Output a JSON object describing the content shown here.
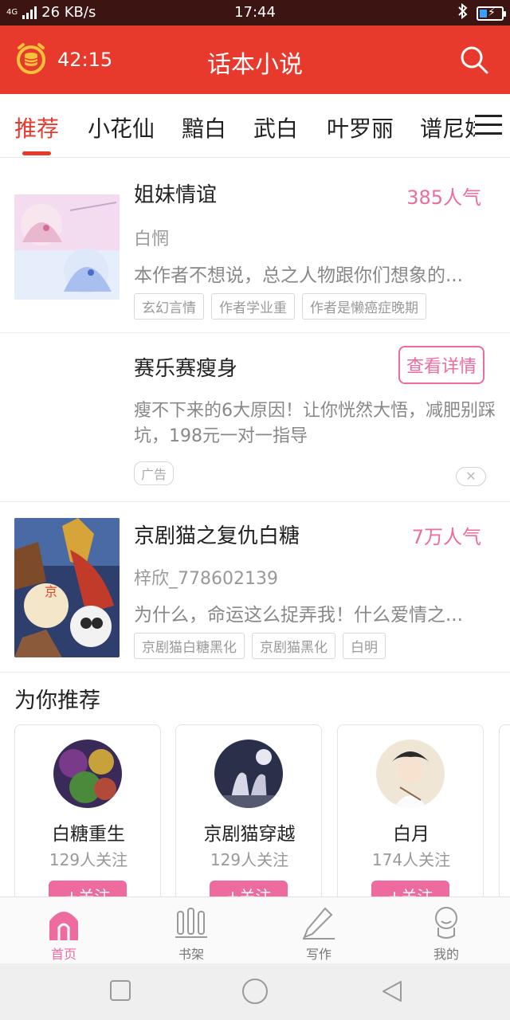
{
  "status_bar": {
    "network": "4G",
    "speed": "26 KB/s",
    "time": "17:44"
  },
  "header": {
    "timer": "42:15",
    "title": "话本小说"
  },
  "tabs": [
    {
      "label": "推荐",
      "active": true
    },
    {
      "label": "小花仙",
      "active": false
    },
    {
      "label": "黯白",
      "active": false
    },
    {
      "label": "武白",
      "active": false
    },
    {
      "label": "叶罗丽",
      "active": false
    },
    {
      "label": "谱尼妹",
      "active": false
    }
  ],
  "feed": {
    "books": [
      {
        "title": "姐妹情谊",
        "popularity": "385人气",
        "author": "白惘",
        "desc": "本作者不想说，总之人物跟你们想象的...",
        "tags": [
          "玄幻言情",
          "作者学业重",
          "作者是懒癌症晚期"
        ]
      },
      {
        "title": "京剧猫之复仇白糖",
        "popularity": "7万人气",
        "author": "梓欣_778602139",
        "desc": "为什么，命运这么捉弄我！什么爱情之...",
        "tags": [
          "京剧猫白糖黑化",
          "京剧猫黑化",
          "白明"
        ]
      }
    ],
    "ad": {
      "title": "赛乐赛瘦身",
      "detail_button": "查看详情",
      "desc": "瘦不下来的6大原因！让你恍然大悟，减肥别踩坑，198元一对一指导",
      "label": "广告",
      "close": "✕"
    }
  },
  "recommend": {
    "title": "为你推荐",
    "items": [
      {
        "name": "白糖重生",
        "followers": "129人关注",
        "follow": "+关注"
      },
      {
        "name": "京剧猫穿越",
        "followers": "129人关注",
        "follow": "+关注"
      },
      {
        "name": "白月",
        "followers": "174人关注",
        "follow": "+关注"
      }
    ]
  },
  "bottom_nav": [
    {
      "label": "首页",
      "icon": "home-icon",
      "active": true
    },
    {
      "label": "书架",
      "icon": "bookshelf-icon",
      "active": false
    },
    {
      "label": "写作",
      "icon": "pen-icon",
      "active": false
    },
    {
      "label": "我的",
      "icon": "profile-icon",
      "active": false
    }
  ],
  "colors": {
    "brand_red": "#e8392d",
    "accent_pink": "#ee6ba0",
    "status_bar": "#3c1411"
  }
}
